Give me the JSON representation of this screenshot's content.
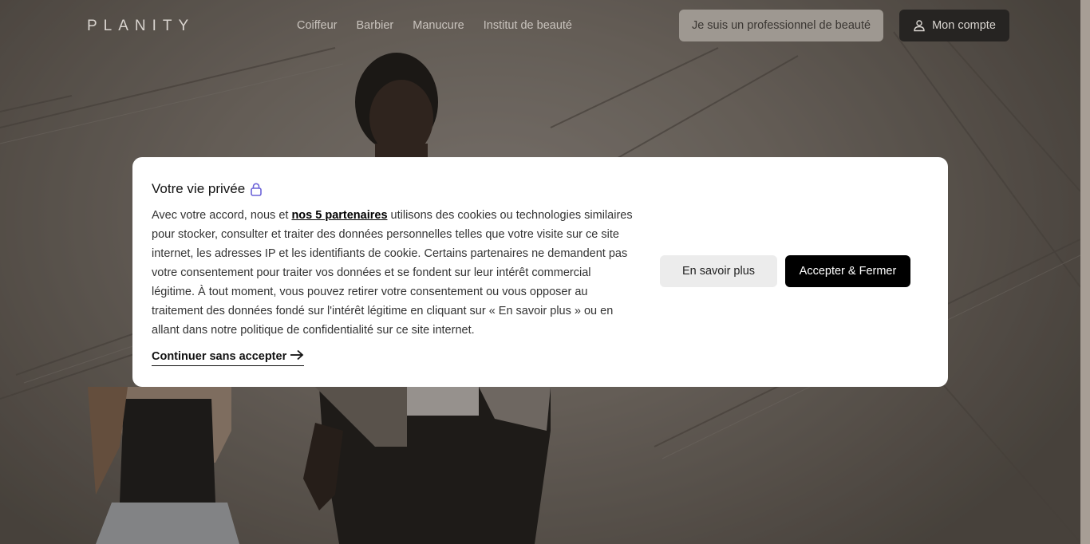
{
  "header": {
    "logo": "PLANITY",
    "nav": [
      "Coiffeur",
      "Barbier",
      "Manucure",
      "Institut de beauté"
    ],
    "pro_label": "Je suis un professionnel de beauté",
    "account_label": "Mon compte"
  },
  "cookie_modal": {
    "title": "Votre vie privée",
    "text_before": "Avec votre accord, nous et ",
    "partners_link": "nos 5 partenaires",
    "text_after": " utilisons des cookies ou technologies similaires pour stocker, consulter et traiter des données personnelles telles que votre visite sur ce site internet, les adresses IP et les identifiants de cookie. Certains partenaires ne demandent pas votre consentement pour traiter vos données et se fondent sur leur intérêt commercial légitime. À tout moment, vous pouvez retirer votre consentement ou vous opposer au traitement des données fondé sur l'intérêt légitime en cliquant sur « En savoir plus » ou en allant dans notre politique de confidentialité sur ce site internet.",
    "continue_label": "Continuer sans accepter",
    "more_label": "En savoir plus",
    "accept_label": "Accepter & Fermer"
  },
  "icons": {
    "lock": "lock-icon",
    "user": "user-icon",
    "arrow": "arrow-right-icon"
  },
  "colors": {
    "lock_accent": "#6c63d8",
    "accept_bg": "#000000",
    "more_bg": "#ececec"
  }
}
